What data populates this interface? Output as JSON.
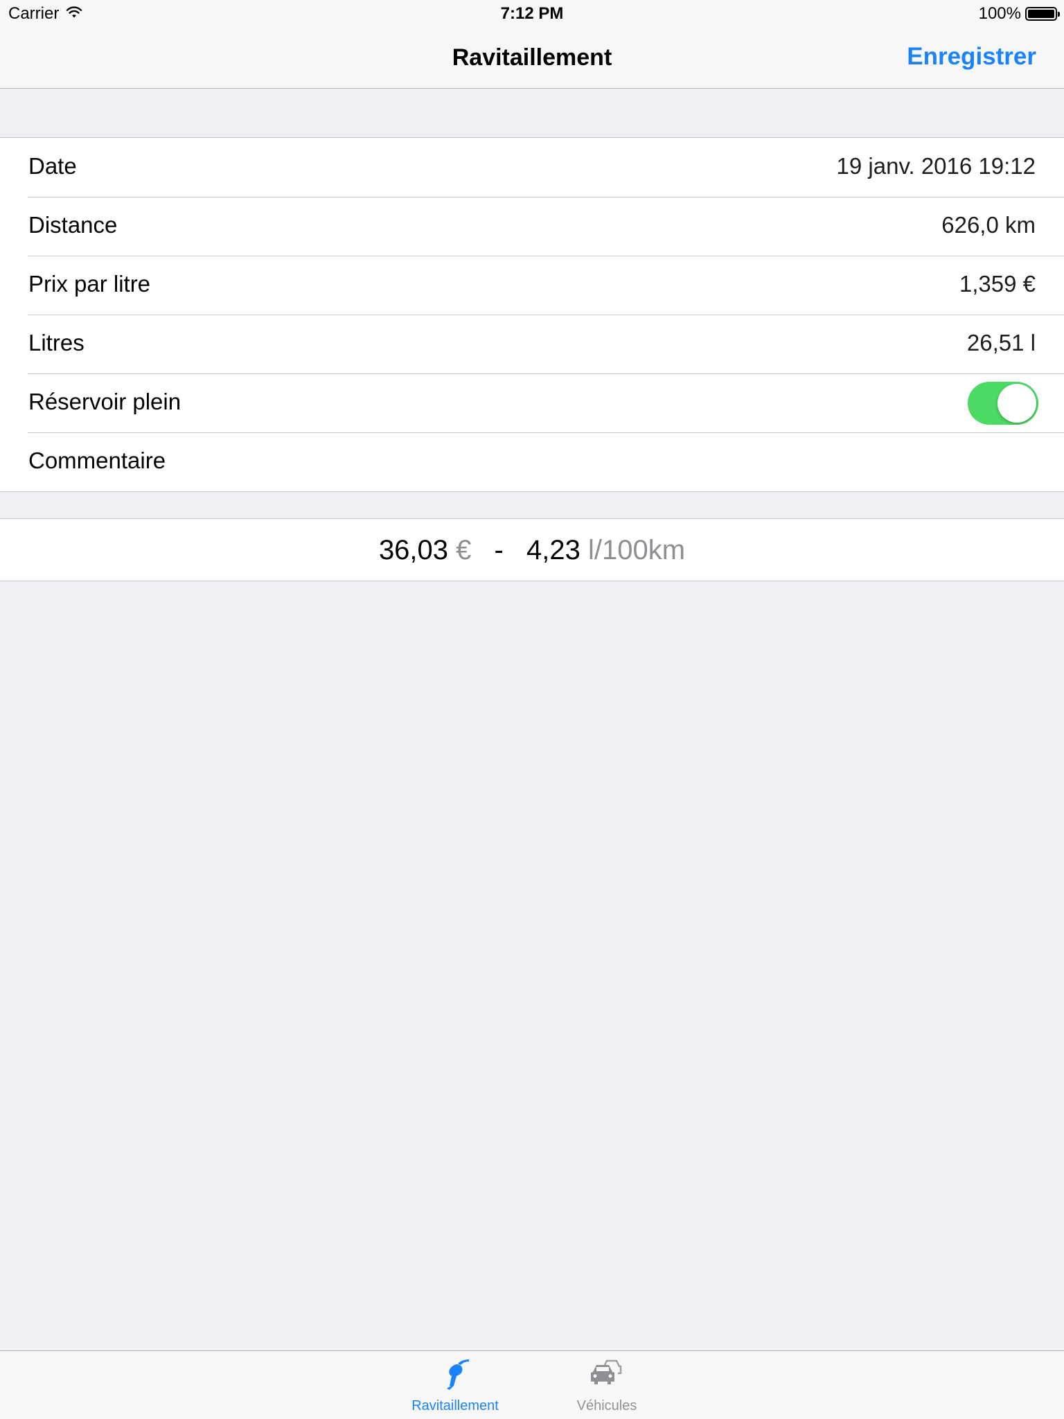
{
  "status_bar": {
    "carrier": "Carrier",
    "time": "7:12 PM",
    "battery": "100%",
    "icons": [
      "wifi-icon",
      "battery-icon"
    ]
  },
  "nav": {
    "title": "Ravitaillement",
    "action_label": "Enregistrer"
  },
  "form": {
    "rows": [
      {
        "label": "Date",
        "value": "19 janv. 2016 19:12"
      },
      {
        "label": "Distance",
        "value": "626,0 km"
      },
      {
        "label": "Prix par litre",
        "value": "1,359 €"
      },
      {
        "label": "Litres",
        "value": "26,51 l"
      },
      {
        "label": "Réservoir plein",
        "toggle_on": true
      },
      {
        "label": "Commentaire",
        "value": ""
      }
    ]
  },
  "summary": {
    "cost": "36,03",
    "cost_unit": "€",
    "separator": "-",
    "consumption": "4,23",
    "consumption_unit": "l/100km"
  },
  "tabs": [
    {
      "label": "Ravitaillement",
      "icon": "fuel-nozzle-icon",
      "active": true
    },
    {
      "label": "Véhicules",
      "icon": "cars-icon",
      "active": false
    }
  ],
  "colors": {
    "accent": "#1a82fb",
    "toggle_on": "#4cd964",
    "background": "#efeff4",
    "inactive": "#929292"
  }
}
